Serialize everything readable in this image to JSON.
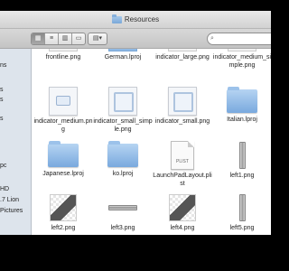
{
  "window": {
    "title": "Resources"
  },
  "toolbar": {
    "view_icon": "icon-view",
    "list_icon": "list-view",
    "column_icon": "column-view",
    "cover_icon": "coverflow-view",
    "arrange_label": "▾",
    "search_placeholder": ""
  },
  "sidebar": {
    "items": [
      {
        "label": "ns"
      },
      {
        "label": "s"
      },
      {
        "label": "s"
      },
      {
        "label": "s"
      },
      {
        "label": "pc"
      },
      {
        "label": "HD"
      },
      {
        "label": ".7 Lion"
      },
      {
        "label": "Pictures"
      }
    ]
  },
  "files": [
    {
      "name": "frontline.png",
      "kind": "partial"
    },
    {
      "name": "German.lproj",
      "kind": "partial"
    },
    {
      "name": "indicator_large.png",
      "kind": "partial"
    },
    {
      "name": "indicator_medium_simple.png",
      "kind": "partial"
    },
    {
      "name": "indicator_medium.png",
      "kind": "image"
    },
    {
      "name": "indicator_small_simple.png",
      "kind": "image-sq"
    },
    {
      "name": "indicator_small.png",
      "kind": "image-sq"
    },
    {
      "name": "Italian.lproj",
      "kind": "folder"
    },
    {
      "name": "Japanese.lproj",
      "kind": "folder"
    },
    {
      "name": "ko.lproj",
      "kind": "folder"
    },
    {
      "name": "LaunchPadLayout.plist",
      "kind": "plist"
    },
    {
      "name": "left1.png",
      "kind": "bar-v"
    },
    {
      "name": "left2.png",
      "kind": "checker"
    },
    {
      "name": "left3.png",
      "kind": "bar-h"
    },
    {
      "name": "left4.png",
      "kind": "checker"
    },
    {
      "name": "left5.png",
      "kind": "bar-v"
    }
  ],
  "plist_badge": "PLIST"
}
